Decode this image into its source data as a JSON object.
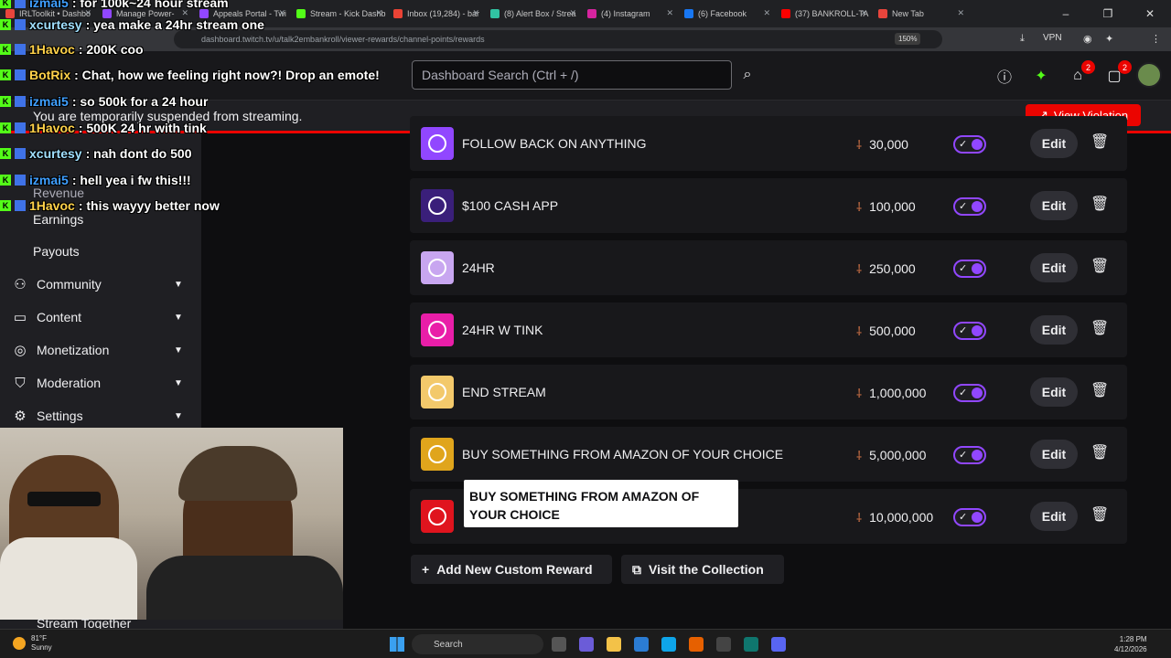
{
  "browser": {
    "tabs": [
      {
        "label": "IRLToolkit • Dashbo",
        "color": "#e8453c"
      },
      {
        "label": "Manage Power-",
        "color": "#9147ff"
      },
      {
        "label": "Appeals Portal - Twi",
        "color": "#9147ff"
      },
      {
        "label": "Stream - Kick Dashb",
        "color": "#53fc18"
      },
      {
        "label": "Inbox (19,284) - bar",
        "color": "#ea4335"
      },
      {
        "label": "(8) Alert Box / Strea",
        "color": "#31c3a2"
      },
      {
        "label": "(4) Instagram",
        "color": "#d6249f"
      },
      {
        "label": "(6) Facebook",
        "color": "#1877f2"
      },
      {
        "label": "(37) BANKROLL-TA",
        "color": "#ff0000"
      },
      {
        "label": "New Tab",
        "color": "#e8453c"
      }
    ],
    "url": "dashboard.twitch.tv/u/talk2embankroll/viewer-rewards/channel-points/rewards",
    "zoom": "150%",
    "vpn": "VPN"
  },
  "header": {
    "search_placeholder": "Dashboard Search (Ctrl + /)",
    "inbox_badge": "2",
    "whisper_badge": "2"
  },
  "banner": {
    "message": "You are temporarily suspended from streaming.",
    "view_violation": "View Violation"
  },
  "sidebar": {
    "subitems": [
      {
        "label": "Earnings"
      },
      {
        "label": "Payouts"
      }
    ],
    "sections": [
      {
        "label": "Community",
        "icon": "community-icon"
      },
      {
        "label": "Content",
        "icon": "content-icon"
      },
      {
        "label": "Monetization",
        "icon": "monetization-icon"
      },
      {
        "label": "Moderation",
        "icon": "moderation-icon"
      },
      {
        "label": "Settings",
        "icon": "settings-icon"
      }
    ],
    "stream_together": "Stream Together"
  },
  "rewards": [
    {
      "title": "FOLLOW BACK ON ANYTHING",
      "cost": "30,000",
      "color": "#9147ff"
    },
    {
      "title": "$100 CASH APP",
      "cost": "100,000",
      "color": "#3a1f7a"
    },
    {
      "title": "24HR",
      "cost": "250,000",
      "color": "#c8a6f0"
    },
    {
      "title": "24HR W TINK",
      "cost": "500,000",
      "color": "#e91ea8"
    },
    {
      "title": "END STREAM",
      "cost": "1,000,000",
      "color": "#f3c96b"
    },
    {
      "title": "BUY SOMETHING FROM AMAZON OF YOUR CHOICE",
      "cost": "5,000,000",
      "color": "#e0a51c"
    },
    {
      "title": "",
      "cost": "10,000,000",
      "color": "#e0141e"
    }
  ],
  "edit_label": "Edit",
  "tooltip": "BUY SOMETHING FROM AMAZON OF YOUR CHOICE",
  "actions": {
    "add_reward": "Add New Custom Reward",
    "visit_collection": "Visit the Collection"
  },
  "chat": [
    {
      "user": "izmai5",
      "msg": ": for 100k~24 hour stream",
      "color": "#3f9fff"
    },
    {
      "user": "xcurtesy",
      "msg": ": yea make a 24hr stream one",
      "color": "#a0e0ff"
    },
    {
      "user": "1Havoc",
      "msg": ": 200K coo",
      "color": "#ffd24a"
    },
    {
      "user": "BotRix",
      "msg": ": Chat, how we feeling right now?! Drop an emote!",
      "color": "#ffd24a"
    },
    {
      "user": "izmai5",
      "msg": ": so 500k for a 24 hour",
      "color": "#3f9fff"
    },
    {
      "user": "1Havoc",
      "msg": ": 500K 24 hr with tink",
      "color": "#ffd24a"
    },
    {
      "user": "xcurtesy",
      "msg": ": nah dont do 500",
      "color": "#a0e0ff"
    },
    {
      "user": "izmai5",
      "msg": ": hell yea i fw this!!!",
      "color": "#3f9fff"
    },
    {
      "user": "1Havoc",
      "msg": ": this wayyy better now",
      "color": "#ffd24a"
    }
  ],
  "sidebar_partial": "Revenue",
  "taskbar": {
    "temp": "81°F",
    "weather": "Sunny",
    "search": "Search",
    "time": "1:28 PM",
    "date": "4/12/2026"
  }
}
